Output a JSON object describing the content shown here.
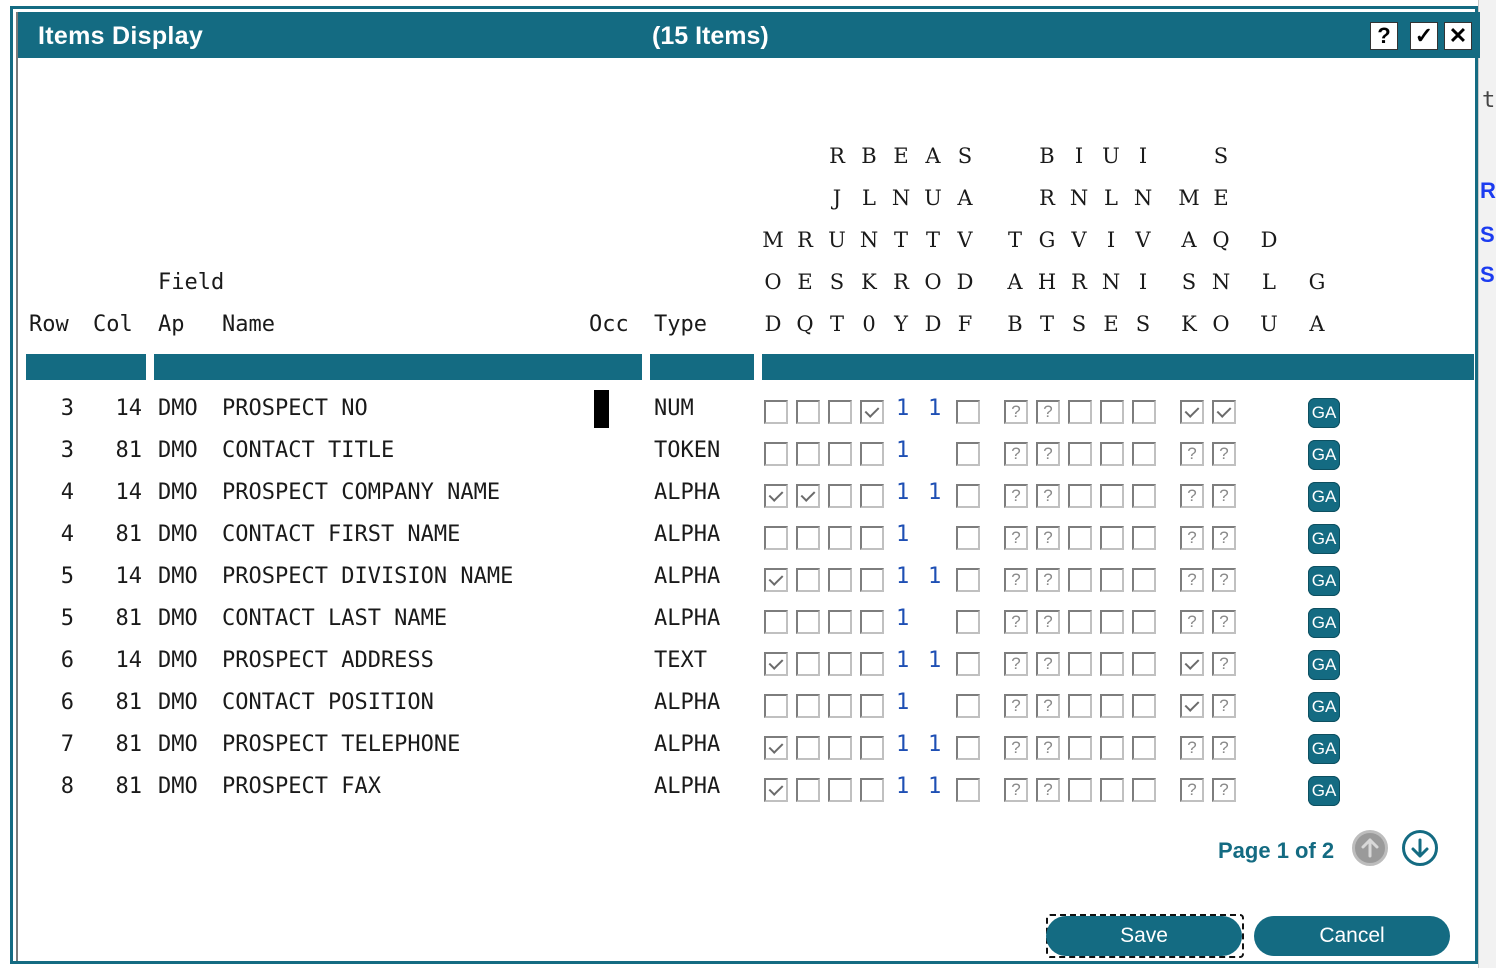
{
  "dialog": {
    "title": "Items Display",
    "item_count": "(15 Items)",
    "help_label": "?",
    "ok_label": "✓",
    "close_label": "✕"
  },
  "headers": {
    "row": "Row",
    "col": "Col",
    "field_top": "Field",
    "ap": "Ap",
    "name": "Name",
    "occ": "Occ",
    "type": "Type"
  },
  "flag_columns": [
    [
      "",
      "",
      "",
      "M",
      "O",
      "D"
    ],
    [
      "",
      "",
      "",
      "R",
      "E",
      "Q"
    ],
    [
      "",
      "R",
      "J",
      "U",
      "S",
      "T"
    ],
    [
      "",
      "B",
      "L",
      "N",
      "K",
      "0"
    ],
    [
      "",
      "E",
      "N",
      "T",
      "R",
      "Y"
    ],
    [
      "",
      "A",
      "U",
      "T",
      "O",
      "D"
    ],
    [
      "",
      "S",
      "A",
      "V",
      "D",
      "F"
    ],
    [
      "",
      "",
      "",
      "T",
      "A",
      "B"
    ],
    [
      "",
      "B",
      "R",
      "G",
      "H",
      "T"
    ],
    [
      "",
      "I",
      "N",
      "V",
      "R",
      "S"
    ],
    [
      "",
      "U",
      "L",
      "I",
      "N",
      "E"
    ],
    [
      "",
      "I",
      "N",
      "V",
      "I",
      "S"
    ],
    [
      "",
      "",
      "M",
      "A",
      "S",
      "K"
    ],
    [
      "",
      "S",
      "E",
      "Q",
      "N",
      "O"
    ],
    [
      "",
      "",
      "",
      "D",
      "L",
      "U"
    ],
    [
      "",
      "",
      "",
      "",
      "G",
      "A"
    ]
  ],
  "rows": [
    {
      "row": "3",
      "col": "14",
      "ap": "DMO",
      "name": "PROSPECT NO",
      "type": "NUM",
      "mod": "u",
      "req": "u",
      "rjust": "u",
      "blnk": "c",
      "entry": "1",
      "autod": "1",
      "savdf": "u",
      "tab": "q",
      "brght": "q",
      "invrs": "u",
      "uline": "u",
      "invis": "u",
      "mask": "c",
      "seqno": "c",
      "ga": "GA"
    },
    {
      "row": "3",
      "col": "81",
      "ap": "DMO",
      "name": "CONTACT TITLE",
      "type": "TOKEN",
      "mod": "u",
      "req": "u",
      "rjust": "u",
      "blnk": "u",
      "entry": "1",
      "autod": "",
      "savdf": "u",
      "tab": "q",
      "brght": "q",
      "invrs": "u",
      "uline": "u",
      "invis": "u",
      "mask": "q",
      "seqno": "q",
      "ga": "GA"
    },
    {
      "row": "4",
      "col": "14",
      "ap": "DMO",
      "name": "PROSPECT COMPANY NAME",
      "type": "ALPHA",
      "mod": "c",
      "req": "c",
      "rjust": "u",
      "blnk": "u",
      "entry": "1",
      "autod": "1",
      "savdf": "u",
      "tab": "q",
      "brght": "q",
      "invrs": "u",
      "uline": "u",
      "invis": "u",
      "mask": "q",
      "seqno": "q",
      "ga": "GA"
    },
    {
      "row": "4",
      "col": "81",
      "ap": "DMO",
      "name": "CONTACT FIRST NAME",
      "type": "ALPHA",
      "mod": "u",
      "req": "u",
      "rjust": "u",
      "blnk": "u",
      "entry": "1",
      "autod": "",
      "savdf": "u",
      "tab": "q",
      "brght": "q",
      "invrs": "u",
      "uline": "u",
      "invis": "u",
      "mask": "q",
      "seqno": "q",
      "ga": "GA"
    },
    {
      "row": "5",
      "col": "14",
      "ap": "DMO",
      "name": "PROSPECT DIVISION NAME",
      "type": "ALPHA",
      "mod": "c",
      "req": "u",
      "rjust": "u",
      "blnk": "u",
      "entry": "1",
      "autod": "1",
      "savdf": "u",
      "tab": "q",
      "brght": "q",
      "invrs": "u",
      "uline": "u",
      "invis": "u",
      "mask": "q",
      "seqno": "q",
      "ga": "GA"
    },
    {
      "row": "5",
      "col": "81",
      "ap": "DMO",
      "name": "CONTACT LAST NAME",
      "type": "ALPHA",
      "mod": "u",
      "req": "u",
      "rjust": "u",
      "blnk": "u",
      "entry": "1",
      "autod": "",
      "savdf": "u",
      "tab": "q",
      "brght": "q",
      "invrs": "u",
      "uline": "u",
      "invis": "u",
      "mask": "q",
      "seqno": "q",
      "ga": "GA"
    },
    {
      "row": "6",
      "col": "14",
      "ap": "DMO",
      "name": "PROSPECT ADDRESS",
      "type": "TEXT",
      "mod": "c",
      "req": "u",
      "rjust": "u",
      "blnk": "u",
      "entry": "1",
      "autod": "1",
      "savdf": "u",
      "tab": "q",
      "brght": "q",
      "invrs": "u",
      "uline": "u",
      "invis": "u",
      "mask": "c",
      "seqno": "q",
      "ga": "GA"
    },
    {
      "row": "6",
      "col": "81",
      "ap": "DMO",
      "name": "CONTACT POSITION",
      "type": "ALPHA",
      "mod": "u",
      "req": "u",
      "rjust": "u",
      "blnk": "u",
      "entry": "1",
      "autod": "",
      "savdf": "u",
      "tab": "q",
      "brght": "q",
      "invrs": "u",
      "uline": "u",
      "invis": "u",
      "mask": "c",
      "seqno": "q",
      "ga": "GA"
    },
    {
      "row": "7",
      "col": "81",
      "ap": "DMO",
      "name": "PROSPECT TELEPHONE",
      "type": "ALPHA",
      "mod": "c",
      "req": "u",
      "rjust": "u",
      "blnk": "u",
      "entry": "1",
      "autod": "1",
      "savdf": "u",
      "tab": "q",
      "brght": "q",
      "invrs": "u",
      "uline": "u",
      "invis": "u",
      "mask": "q",
      "seqno": "q",
      "ga": "GA"
    },
    {
      "row": "8",
      "col": "81",
      "ap": "DMO",
      "name": "PROSPECT FAX",
      "type": "ALPHA",
      "mod": "c",
      "req": "u",
      "rjust": "u",
      "blnk": "u",
      "entry": "1",
      "autod": "1",
      "savdf": "u",
      "tab": "q",
      "brght": "q",
      "invrs": "u",
      "uline": "u",
      "invis": "u",
      "mask": "q",
      "seqno": "q",
      "ga": "GA"
    }
  ],
  "pagination": {
    "label": "Page 1 of 2",
    "prev_icon": "arrow-up-icon",
    "next_icon": "arrow-down-icon"
  },
  "buttons": {
    "save": "Save",
    "cancel": "Cancel"
  },
  "colors": {
    "accent": "#146b82",
    "link_blue": "#1e4fb4"
  }
}
